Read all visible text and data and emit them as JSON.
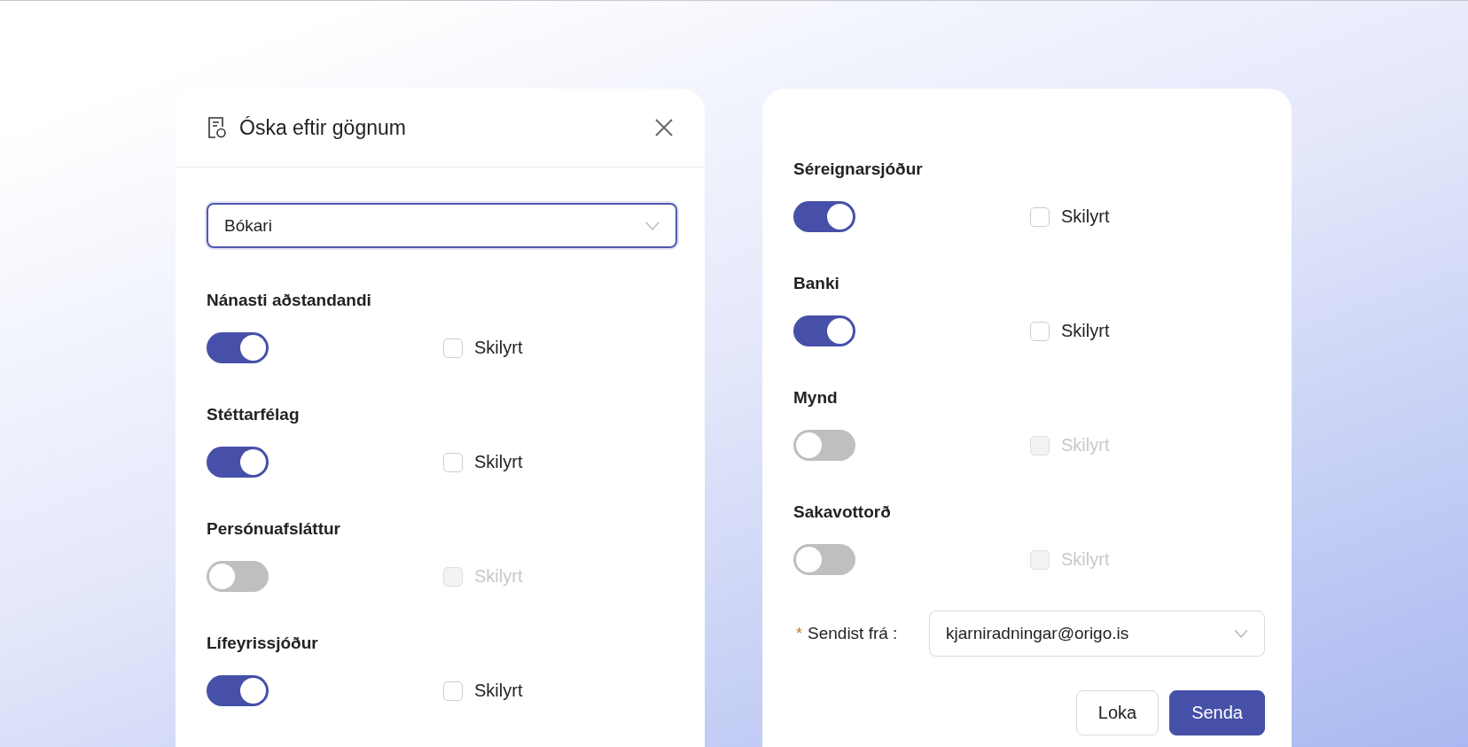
{
  "dialog": {
    "title": "Óska eftir gögnum",
    "select": {
      "value": "Bókari"
    }
  },
  "left_items": [
    {
      "label": "Nánasti aðstandandi",
      "on": true,
      "checkbox": {
        "label": "Skilyrt",
        "checked": false,
        "disabled": false
      }
    },
    {
      "label": "Stéttarfélag",
      "on": true,
      "checkbox": {
        "label": "Skilyrt",
        "checked": false,
        "disabled": false
      }
    },
    {
      "label": "Persónuafsláttur",
      "on": false,
      "checkbox": {
        "label": "Skilyrt",
        "checked": false,
        "disabled": true
      }
    },
    {
      "label": "Lífeyrissjóður",
      "on": true,
      "checkbox": {
        "label": "Skilyrt",
        "checked": false,
        "disabled": false
      }
    }
  ],
  "right_items": [
    {
      "label": "Séreignarsjóður",
      "on": true,
      "checkbox": {
        "label": "Skilyrt",
        "checked": false,
        "disabled": false
      }
    },
    {
      "label": "Banki",
      "on": true,
      "checkbox": {
        "label": "Skilyrt",
        "checked": false,
        "disabled": false
      }
    },
    {
      "label": "Mynd",
      "on": false,
      "checkbox": {
        "label": "Skilyrt",
        "checked": false,
        "disabled": true
      }
    },
    {
      "label": "Sakavottorð",
      "on": false,
      "checkbox": {
        "label": "Skilyrt",
        "checked": false,
        "disabled": true
      }
    }
  ],
  "sender": {
    "required_mark": "*",
    "label": "Sendist frá :",
    "value": "kjarniradningar@origo.is"
  },
  "buttons": [
    {
      "label": "Loka",
      "kind": "default"
    },
    {
      "label": "Senda",
      "kind": "primary"
    }
  ]
}
